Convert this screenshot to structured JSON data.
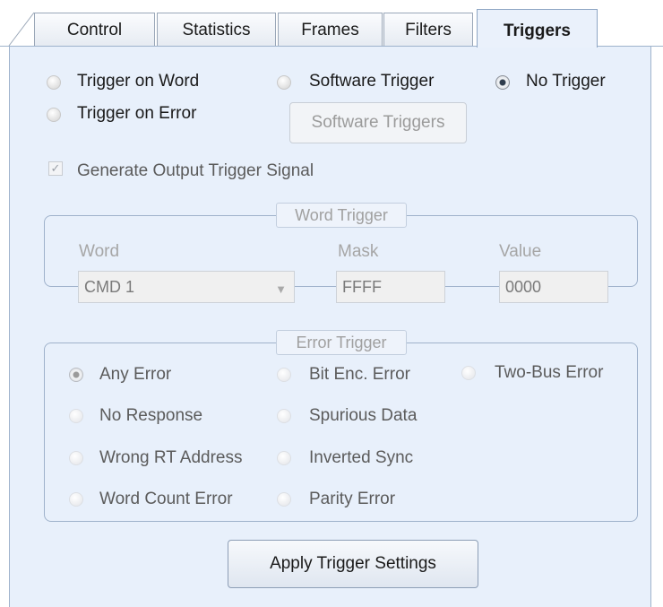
{
  "tabs": [
    {
      "label": "Control"
    },
    {
      "label": "Statistics"
    },
    {
      "label": "Frames"
    },
    {
      "label": "Filters"
    },
    {
      "label": "Triggers",
      "active": true
    }
  ],
  "trigger_mode": {
    "options": [
      "Trigger on Word",
      "Software Trigger",
      "No Trigger",
      "Trigger on Error"
    ],
    "selected": "No Trigger"
  },
  "software_triggers_button": "Software Triggers",
  "output_trigger": {
    "label": "Generate Output Trigger Signal",
    "checked": true
  },
  "word_trigger": {
    "title": "Word Trigger",
    "word_label": "Word",
    "word_value": "CMD 1",
    "mask_label": "Mask",
    "mask_value": "FFFF",
    "value_label": "Value",
    "value_value": "0000"
  },
  "error_trigger": {
    "title": "Error Trigger",
    "options": [
      "Any Error",
      "Bit Enc. Error",
      "Two-Bus Error",
      "No Response",
      "Spurious Data",
      "Wrong RT Address",
      "Inverted Sync",
      "Word Count Error",
      "Parity Error"
    ],
    "selected": "Any Error"
  },
  "apply_button": "Apply Trigger Settings",
  "colors": {
    "panel_bg": "#e8f0fb",
    "border": "#9fb3cc",
    "accent": "#2f3d4d"
  }
}
